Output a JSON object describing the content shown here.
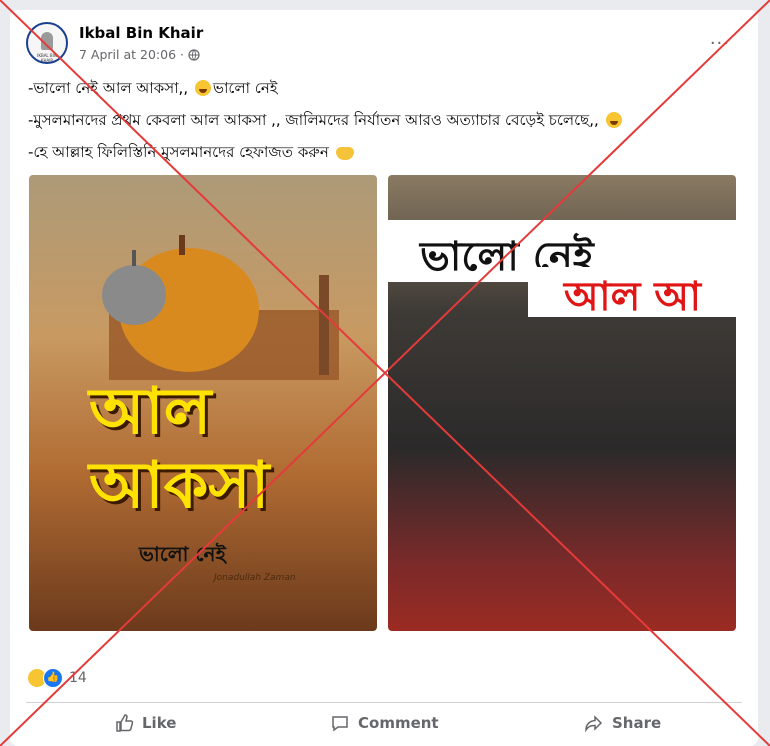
{
  "post": {
    "author": "Ikbal Bin Khair",
    "timestamp": "7 April at 20:06 · ",
    "avatar_caption": "IKBAL BIN KHAIR",
    "more_label": "...",
    "lines": [
      "-ভালো নেই আল আকসা,,",
      "ভালো নেই",
      "-মুসলমানদের প্রথম কেবলা আল আকসা ,, জালিমদের নির্যাতন আরও অত্যাচার বেড়েই চলেছে,,",
      "-হে আল্লাহ ফিলিস্তিনি মুসলমানদের হেফাজত করুন"
    ]
  },
  "images": {
    "left": {
      "title": "আল আকসা",
      "subtitle": "ভালো নেই",
      "signature": "Jonadullah Zaman"
    },
    "right": {
      "banner": "ভালো নেই",
      "banner_red": "আল আ"
    }
  },
  "reactions": {
    "count": "14"
  },
  "actions": {
    "like": "Like",
    "comment": "Comment",
    "share": "Share"
  },
  "colors": {
    "cross": "#e53a3a",
    "link_blue": "#1877f2"
  },
  "icons": [
    "globe-icon",
    "more-icon",
    "like-icon",
    "comment-icon",
    "share-icon"
  ]
}
